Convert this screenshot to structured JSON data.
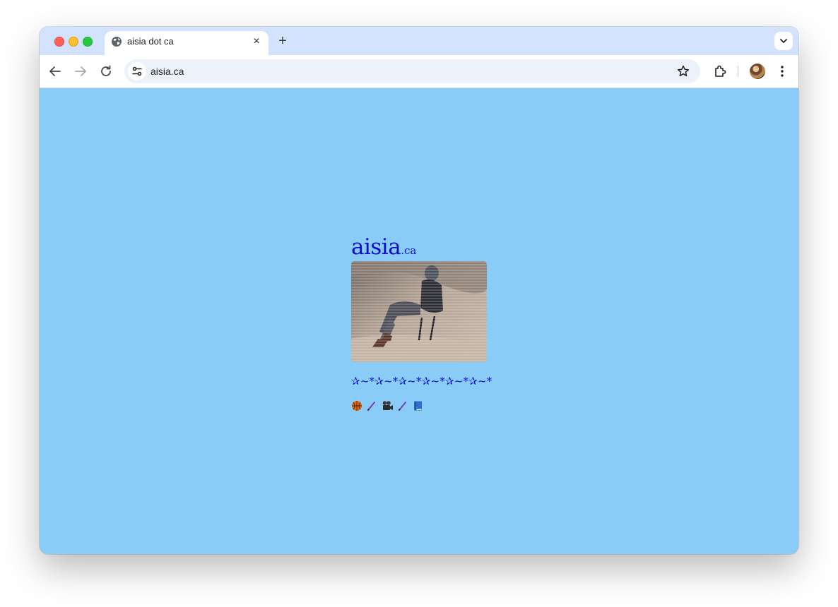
{
  "browser": {
    "tab": {
      "title": "aisia dot ca",
      "favicon": "globe-icon",
      "close": "×"
    },
    "new_tab": "+",
    "address_bar": {
      "url": "aisia.ca"
    }
  },
  "page": {
    "background": "#89ccf8",
    "accent_color": "#0a0acd",
    "site_name_main": "aisia",
    "site_name_tld": ".ca",
    "photo_overlay_text": "",
    "stars": "✰~*✰~*✰~*✰~*✰~*✰~*",
    "links": [
      {
        "icon": "basketball-icon"
      },
      {
        "icon": "pencil-icon"
      },
      {
        "icon": "movie-camera-icon"
      },
      {
        "icon": "pencil-icon"
      },
      {
        "icon": "book-icon"
      }
    ]
  }
}
